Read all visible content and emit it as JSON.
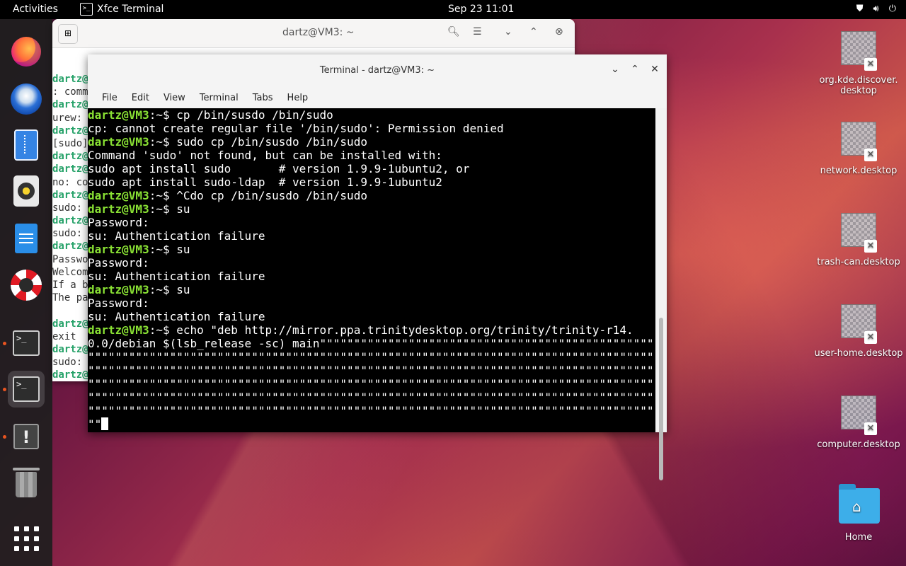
{
  "topbar": {
    "activities": "Activities",
    "app_name": "Xfce Terminal",
    "app_icon_glyph": ">_",
    "clock": "Sep 23  11:01"
  },
  "dock": {
    "items": [
      "firefox-icon",
      "thunderbird-icon",
      "files-icon",
      "rhythmbox-icon",
      "writer-icon",
      "help-icon",
      "terminal-icon",
      "terminal-active-icon",
      "warning-icon",
      "trash-icon",
      "app-grid-icon"
    ]
  },
  "back_window": {
    "title": "dartz@VM3: ~",
    "lines": [
      {
        "g": "dartz@",
        "t": ""
      },
      {
        "g": "",
        "t": ": comm"
      },
      {
        "g": "dartz@",
        "t": ""
      },
      {
        "g": "",
        "t": "urew: "
      },
      {
        "g": "dartz@",
        "t": ""
      },
      {
        "g": "",
        "t": "[sudo]"
      },
      {
        "g": "dartz@",
        "t": ""
      },
      {
        "g": "dartz@",
        "t": ""
      },
      {
        "g": "",
        "t": "no: co"
      },
      {
        "g": "dartz@",
        "t": ""
      },
      {
        "g": "",
        "t": "sudo: "
      },
      {
        "g": "dartz@",
        "t": ""
      },
      {
        "g": "",
        "t": "sudo: "
      },
      {
        "g": "dartz@",
        "t": ""
      },
      {
        "g": "",
        "t": "Passwo"
      },
      {
        "g": "",
        "t": "Welcom"
      },
      {
        "g": "",
        "t": "If a b"
      },
      {
        "g": "",
        "t": "The pa"
      },
      {
        "g": "",
        "t": ""
      },
      {
        "g": "dartz@",
        "t": ""
      },
      {
        "g": "",
        "t": "exit"
      },
      {
        "g": "dartz@",
        "t": ""
      },
      {
        "g": "",
        "t": "sudo: "
      },
      {
        "g": "dartz@",
        "t": ""
      }
    ]
  },
  "front_window": {
    "title": "Terminal - dartz@VM3: ~",
    "menu": [
      "File",
      "Edit",
      "View",
      "Terminal",
      "Tabs",
      "Help"
    ],
    "lines": [
      {
        "p": "dartz@VM3",
        "t": ":~$ cp /bin/susdo /bin/sudo"
      },
      {
        "p": "",
        "t": "cp: cannot create regular file '/bin/sudo': Permission denied"
      },
      {
        "p": "dartz@VM3",
        "t": ":~$ sudo cp /bin/susdo /bin/sudo"
      },
      {
        "p": "",
        "t": "Command 'sudo' not found, but can be installed with:"
      },
      {
        "p": "",
        "t": "sudo apt install sudo       # version 1.9.9-1ubuntu2, or"
      },
      {
        "p": "",
        "t": "sudo apt install sudo-ldap  # version 1.9.9-1ubuntu2"
      },
      {
        "p": "dartz@VM3",
        "t": ":~$ ^Cdo cp /bin/susdo /bin/sudo"
      },
      {
        "p": "dartz@VM3",
        "t": ":~$ su"
      },
      {
        "p": "",
        "t": "Password:"
      },
      {
        "p": "",
        "t": "su: Authentication failure"
      },
      {
        "p": "dartz@VM3",
        "t": ":~$ su"
      },
      {
        "p": "",
        "t": "Password:"
      },
      {
        "p": "",
        "t": "su: Authentication failure"
      },
      {
        "p": "dartz@VM3",
        "t": ":~$ su"
      },
      {
        "p": "",
        "t": "Password:"
      },
      {
        "p": "",
        "t": "su: Authentication failure"
      },
      {
        "p": "dartz@VM3",
        "t": ":~$ echo \"deb http://mirror.ppa.trinitydesktop.org/trinity/trinity-r14."
      },
      {
        "p": "",
        "t": "0.0/debian $(lsb_release -sc) main\"\"\"\"\"\"\"\"\"\"\"\"\"\"\"\"\"\"\"\"\"\"\"\"\"\"\"\"\"\"\"\"\"\"\"\"\"\"\"\"\"\"\"\"\"\"\"\"\"\"\"\"\"\"\"\"\"\"\"\"\"\"\"\"\"\"\"\"\"\"\"\"\"\"\"\"\"\"\"\"\"\"\"\"\"\"\"\"\"\"\"\"\""
      },
      {
        "p": "",
        "t": "\"\"\"\"\"\"\"\"\"\"\"\"\"\"\"\"\"\"\"\"\"\"\"\"\"\"\"\"\"\"\"\"\"\"\"\"\"\"\"\"\"\"\"\"\"\"\"\"\"\"\"\"\"\"\"\"\"\"\"\"\"\"\"\"\"\"\"\"\"\"\"\"\"\"\"\"\"\"\"\"\"\"\"\"\"\"\"\"\"\"\"\"\"\"\"\"\"\"\"\"\"\"\"\"\"\"\"\"\"\"\"\"\"\"\"\"\"\"\"\"\"\"\"\"\"\"\"\"\"\"\"\"\"\"\"\"\"\"\"\"\"\"\"\"\"\"\"\"\"\"\"\"\"\"\"\"\"\"\"\"\"\"\"\"\"\"\"\"\"\"\"\"\"\"\"\"\"\"\"\"\"\"\"\"\""
      },
      {
        "p": "",
        "t": "\"\"\"\"\"\"\"\"\"\"\"\"\"\"\"\"\"\"\"\"\"\"\"\"\"\"\"\"\"\"\"\"\"\"\"\"\"\"\"\"\"\"\"\"\"\"\"\"\"\"\"\"\"\"\"\"\"\"\"\"\"\"\"\"\"\"\"\"\"\"\"\"\"\"\"\"\"\"\"\"\"\"\"\"\"\"\"\"\"\"\"\"\"\"\"\"\"\"\"\"\"\"\"\"\"\"\"\"\"\"\"\"\"\"\"\"\"\"\"\"\"\"\"\"\"\"\"\"\"\"\"\"\"\"\"\"\"\"\"\"\"\"\"\"\"\"\"\"\"\"\"\"\"\"\"\"\"\"\"\"\"\"\"\"\"\"\"\"\"\"\"\"\"\"\"\"\"\"\"\"\"\"\"\"\"\""
      },
      {
        "p": "",
        "t": "\"\"\"\"\"\"\"\"\"\"\"\"\"\"\"\"\"\"\"\"\"\"\"\"\"\"\"\"\"\"\"\"\"\"\"\"\"\"\"\"\"\"\"\"\"\"\"\"\"\"\"\"\"\"\"\"\"\"\"\"\"\"\"\"\"\"\"\"\"\"\"\"\"\"\"\"\"\"\"\"\"\"\"\"\"\"\"\"\"\"\"\"\"\"\"\"\"\"\"\"\"\"\"\"\"\"\"\"\"\"\"\"\"\"\"\"\"\"\"\"\"\"\"\"\"\"\"\"\"\"\"\"\"\"\"\"\"\"\"\"\"\"\"\"\"\"\"\"\"\"\"\"\"\"\"\"\"\"\"\"\"\"\"\"\"\"\"\"\"\"\"\"\"\"\"\"\"\"\"\"\"\"\"\"\"\""
      },
      {
        "p": "",
        "t": "\"\"\"\"\"\"\"\"\"\"\"\"\"\"\"\"\"\"\"\"\"\"\"\"\"\"\"\"\"\"\"\"\"\"\"\"\"\"\"\"\"\"\"\"\"\"\"\"\"\"\"\"\"\"\"\"\"\"\"\"\"\"\"\"\"\"\"\"\"\"\"\"\"\"\"\"\"\"\"\"\"\"\"\"\"\"\"\"\"\"\"\"\"\"\"\"\"\"\"\"\"\"\"\"\"\"\"\"\"\"\"\"\"\"\"\"\"\"\"\"\"\"\"\"\"\"\"\"\"\"\"\"\"\"\"\"\"\"\"\"\"\"\"\"\"\"\"\"\"\"\"\"\"\"\"\"\"\"\"\"\"\"\"\"\"\"\"\"\"\"\"\"\"\"\"\"\"\"\"\"\"\"\"\""
      },
      {
        "p": "",
        "t": "\"\"\"\"\"\"\"\"\"\"\"\"\"\"\"\"\"\"\"\"\"\"\"\"\"\"\"\"\"\"\"\"\"\"\"\"\"\"\"\"\"\"\"\"\"\"\"\"\"\"\"\"\"\"\"\"\"\"\"\"\"\"\"\"\"\"\"\"\"\"\"\"\"\"\"\"\"\"\"\"\"\"\"\"\"\"\"\"\"\"\"\"\"\"\"\"\"\"\"\"\"\"\"\"\"\"\"\"\"\"\"\"\"\"\"\"\"\"\"\"\"\"\"\"\"\"\"\"\"\"\"\"\"\"\"\"\"\"\"\"\"\"\"\"\"\"\"\"\"\"\"\"\"\"\"\"\"\"\"\"\"\"\"\"\"\"\"\"\"\"\"\"\"\"\"\"\"\"\"\"\"\"\"\"\"\""
      },
      {
        "p": "",
        "t": "\"\""
      }
    ]
  },
  "desktop_icons": [
    {
      "label": "org.kde.discover.\ndesktop",
      "icon": "generic-file-icon"
    },
    {
      "label": "network.desktop",
      "icon": "generic-file-icon"
    },
    {
      "label": "trash-can.desktop",
      "icon": "generic-file-icon"
    },
    {
      "label": "user-home.desktop",
      "icon": "generic-file-icon"
    },
    {
      "label": "computer.desktop",
      "icon": "generic-file-icon"
    },
    {
      "label": "Home",
      "icon": "home-folder-icon"
    }
  ]
}
